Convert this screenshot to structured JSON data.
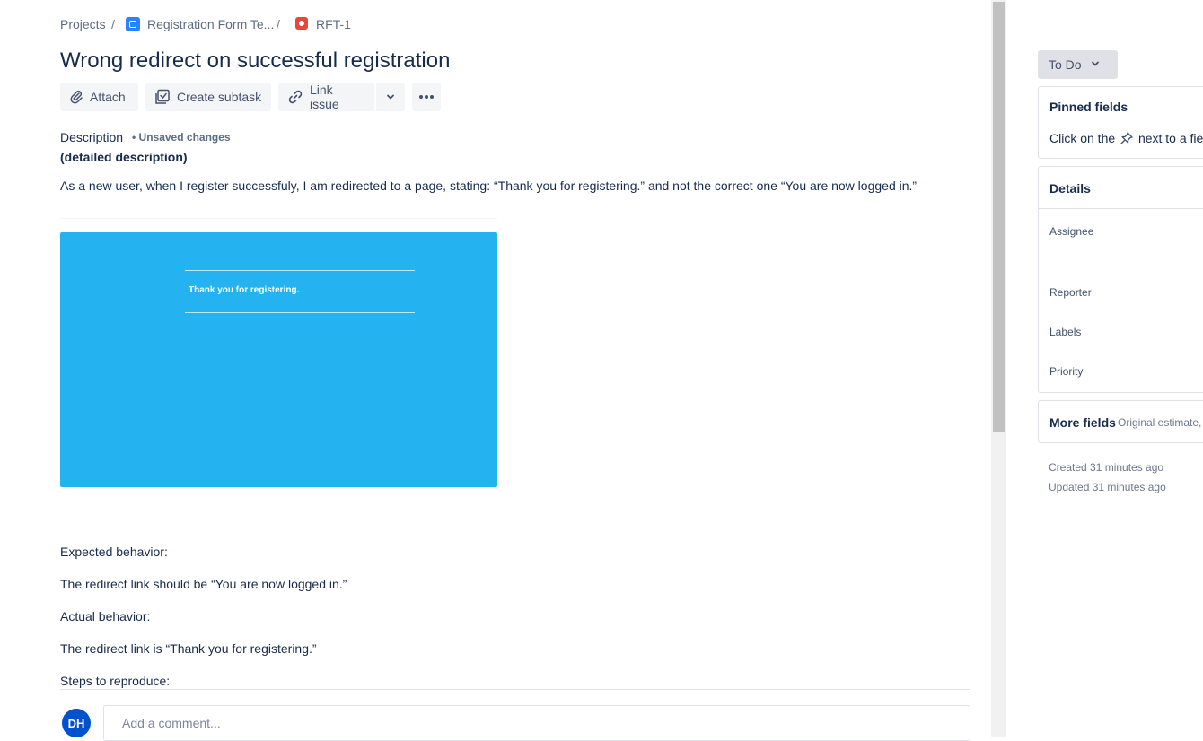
{
  "breadcrumb": {
    "projects": "Projects",
    "project": "Registration Form Te...",
    "issue_key": "RFT-1",
    "separator": "/"
  },
  "issue": {
    "title": "Wrong redirect on successful registration"
  },
  "toolbar": {
    "attach": "Attach",
    "create_subtask": "Create subtask",
    "link_issue": "Link issue"
  },
  "description": {
    "label": "Description",
    "unsaved": "• Unsaved changes",
    "subtitle": "(detailed description)",
    "intro": "As a new user, when I register successfuly, I am redirected to a page, stating: “Thank you for registering.” and not the correct one “You are now logged in.”",
    "screenshot_text": "Thank you for registering.",
    "expected_label": "Expected behavior:",
    "expected": "The redirect link should be “You are now logged in.”",
    "actual_label": "Actual behavior:",
    "actual": "The redirect link is “Thank you for registering.”",
    "steps_label": "Steps to reproduce:"
  },
  "comment": {
    "avatar_initials": "DH",
    "placeholder": "Add a comment..."
  },
  "sidebar": {
    "status": "To Do",
    "pinned_title": "Pinned fields",
    "pinned_hint_before": "Click on the",
    "pinned_hint_after": "next to a field",
    "details_title": "Details",
    "fields": {
      "assignee": "Assignee",
      "reporter": "Reporter",
      "labels": "Labels",
      "priority": "Priority"
    },
    "more_fields": "More fields",
    "more_fields_hint": "Original estimate,",
    "created": "Created 31 minutes ago",
    "updated": "Updated 31 minutes ago"
  },
  "colors": {
    "accent": "#0052cc",
    "bug": "#e5493a",
    "screenshot_bg": "#24b3f0"
  }
}
